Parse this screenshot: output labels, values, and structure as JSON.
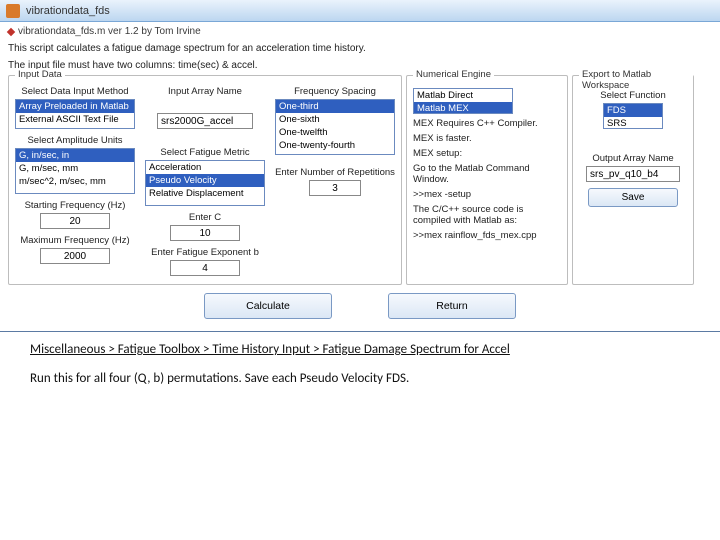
{
  "window": {
    "title": "vibrationdata_fds"
  },
  "header": {
    "version_line": "vibrationdata_fds.m  ver 1.2  by Tom Irvine",
    "desc1": "This script calculates a fatigue damage spectrum for an acceleration time history.",
    "desc2": "The input file must have two columns:  time(sec) & accel."
  },
  "input": {
    "panel_label": "Input Data",
    "col1": {
      "method_label": "Select Data Input Method",
      "method_opts": [
        "Array Preloaded in Matlab",
        "External ASCII Text File"
      ],
      "method_sel": 0,
      "amp_label": "Select Amplitude Units",
      "amp_opts": [
        "G, in/sec, in",
        "G, m/sec, mm",
        "m/sec^2, m/sec, mm"
      ],
      "amp_sel": 0,
      "start_label": "Starting Frequency (Hz)",
      "start_val": "20",
      "max_label": "Maximum Frequency (Hz)",
      "max_val": "2000"
    },
    "col2": {
      "arr_label": "Input Array Name",
      "arr_val": "srs2000G_accel",
      "metric_label": "Select Fatigue Metric",
      "metric_opts": [
        "Acceleration",
        "Pseudo Velocity",
        "Relative Displacement"
      ],
      "metric_sel": 1,
      "c_label": "Enter C",
      "c_val": "10",
      "exp_label": "Enter Fatigue Exponent b",
      "exp_val": "4"
    },
    "col3": {
      "spacing_label": "Frequency Spacing",
      "spacing_opts": [
        "One-third",
        "One-sixth",
        "One-twelfth",
        "One-twenty-fourth"
      ],
      "spacing_sel": 0,
      "rep_label": "Enter Number of Repetitions",
      "rep_val": "3"
    }
  },
  "numeric": {
    "panel_label": "Numerical Engine",
    "opts": [
      "Matlab Direct",
      "Matlab MEX"
    ],
    "sel": 1,
    "line1": "MEX Requires C++ Compiler.",
    "line2": "MEX is faster.",
    "line3": "MEX setup:",
    "line4": "Go to the Matlab Command Window.",
    "line5": ">>mex -setup",
    "line6": "The C/C++ source code is compiled with Matlab as:",
    "line7": ">>mex rainflow_fds_mex.cpp"
  },
  "export": {
    "panel_label": "Export to Matlab Workspace",
    "func_label": "Select Function",
    "func_opts": [
      "FDS",
      "SRS"
    ],
    "func_sel": 0,
    "out_label": "Output Array Name",
    "out_val": "srs_pv_q10_b4",
    "save_label": "Save"
  },
  "buttons": {
    "calc": "Calculate",
    "ret": "Return"
  },
  "caption": {
    "line1": "Miscellaneous > Fatigue Toolbox > Time History Input >  Fatigue Damage Spectrum for Accel",
    "line2": "Run this for all four (Q, b) permutations.  Save each Pseudo Velocity FDS."
  }
}
